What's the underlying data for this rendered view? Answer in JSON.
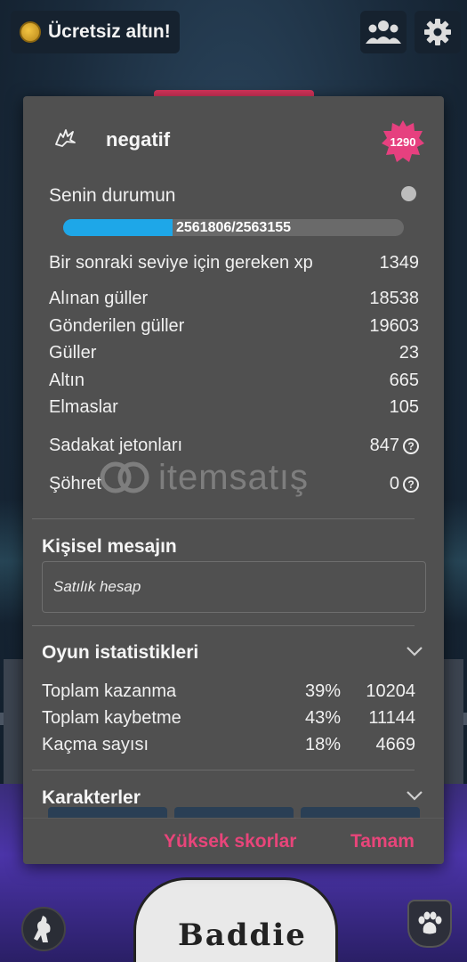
{
  "topbar": {
    "free_gold_label": "Ücretsiz altın!"
  },
  "profile": {
    "username": "negatif",
    "level": "1290"
  },
  "status": {
    "title": "Senin durumun",
    "xp_text": "2561806/2563155",
    "xp_progress": 0.32
  },
  "stats": [
    {
      "label": "Bir sonraki seviye için gereken xp",
      "value": "1349"
    },
    {
      "label": "Alınan güller",
      "value": "18538"
    },
    {
      "label": "Gönderilen güller",
      "value": "19603"
    },
    {
      "label": "Güller",
      "value": "23"
    },
    {
      "label": "Altın",
      "value": "665"
    },
    {
      "label": "Elmaslar",
      "value": "105"
    },
    {
      "label": "Sadakat jetonları",
      "value": "847"
    },
    {
      "label": "Şöhret",
      "value": "0"
    }
  ],
  "help_glyph": "?",
  "personal_message": {
    "title": "Kişisel mesajın",
    "text": "Satılık hesap"
  },
  "game_stats": {
    "title": "Oyun istatistikleri",
    "rows": [
      {
        "label": "Toplam kazanma",
        "pct": "39%",
        "count": "10204"
      },
      {
        "label": "Toplam kaybetme",
        "pct": "43%",
        "count": "11144"
      },
      {
        "label": "Kaçma sayısı",
        "pct": "18%",
        "count": "4669"
      }
    ]
  },
  "characters": {
    "title": "Karakterler"
  },
  "footer": {
    "highscores_label": "Yüksek skorlar",
    "ok_label": "Tamam"
  },
  "watermark": {
    "text": "itemsatış"
  },
  "background": {
    "jersey_text": "Baddie"
  },
  "colors": {
    "accent": "#e8457a",
    "xp_fill": "#1ea7e8",
    "dialog_bg": "#505050",
    "level_badge": "#e6407f"
  }
}
